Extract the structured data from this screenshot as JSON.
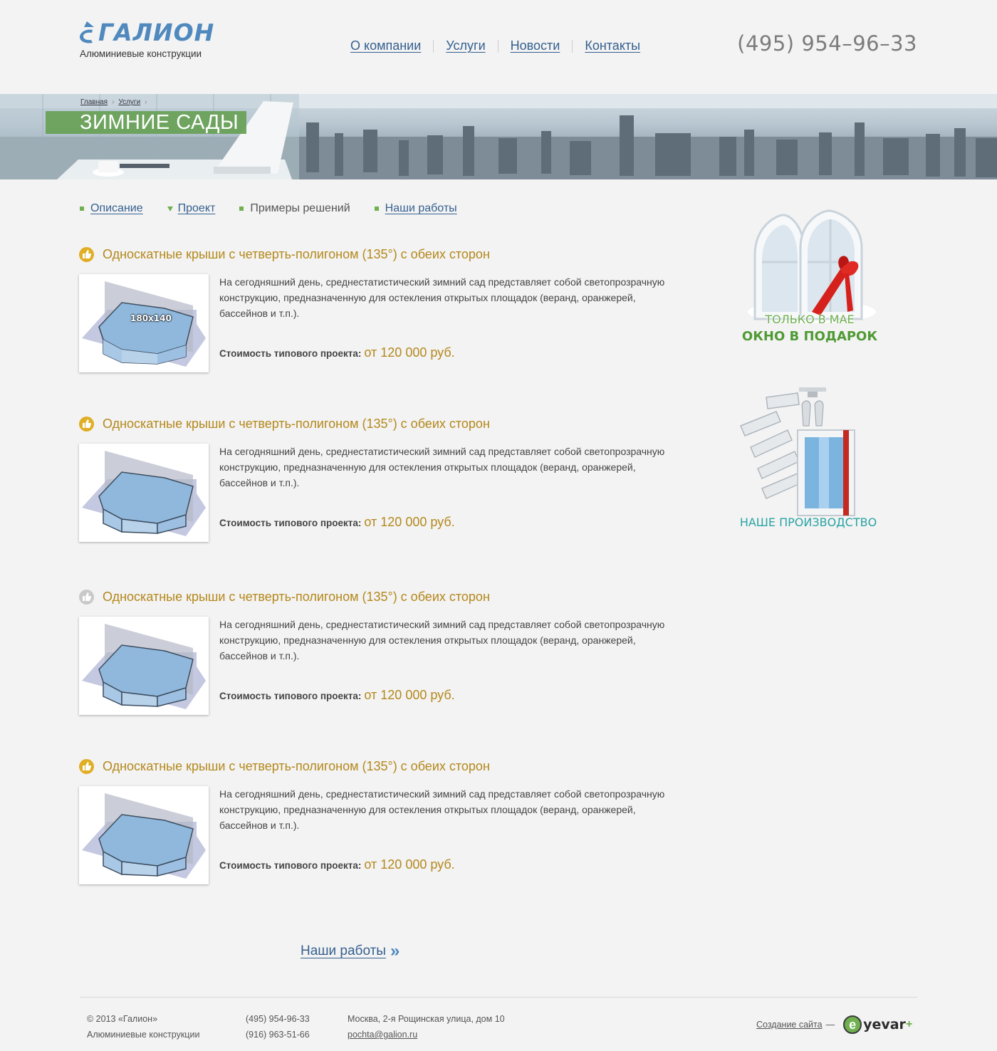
{
  "header": {
    "logo_text": "ГАЛИОН",
    "logo_sub": "Алюминиевые конструкции",
    "nav": [
      "О компании",
      "Услуги",
      "Новости",
      "Контакты"
    ],
    "phone": "(495) 954–96–33"
  },
  "banner": {
    "breadcrumbs": [
      "Главная",
      "Услуги"
    ],
    "title": "ЗИМНИЕ САДЫ"
  },
  "subnav": {
    "items": [
      "Описание",
      "Проект",
      "Примеры решений",
      "Наши работы"
    ]
  },
  "projects": [
    {
      "title": "Односкатные крыши с четверть-полигоном (135°) с обеих сторон",
      "image_label": "180x140",
      "description": "На сегодняшний день, среднестатистический зимний сад представляет собой светопрозрачную конструкцию, предназначенную для остекления открытых площадок (веранд, оранжерей, бассейнов и т.п.).",
      "price_label": "Стоимость типового проекта:",
      "price_value": "от 120 000 руб."
    },
    {
      "title": "Односкатные крыши с четверть-полигоном (135°) с обеих сторон",
      "description": "На сегодняшний день, среднестатистический зимний сад представляет собой светопрозрачную конструкцию, предназначенную для остекления открытых площадок (веранд, оранжерей, бассейнов и т.п.).",
      "price_label": "Стоимость типового проекта:",
      "price_value": "от 120 000 руб."
    },
    {
      "title": "Односкатные крыши с четверть-полигоном (135°) с обеих сторон",
      "description": "На сегодняшний день, среднестатистический зимний сад представляет собой светопрозрачную конструкцию, предназначенную для остекления открытых площадок (веранд, оранжерей, бассейнов и т.п.).",
      "price_label": "Стоимость типового проекта:",
      "price_value": "от 120 000 руб."
    },
    {
      "title": "Односкатные крыши с четверть-полигоном (135°) с обеих сторон",
      "description": "На сегодняшний день, среднестатистический зимний сад представляет собой светопрозрачную конструкцию, предназначенную для остекления открытых площадок (веранд, оранжерей, бассейнов и т.п.).",
      "price_label": "Стоимость типового проекта:",
      "price_value": "от 120 000 руб."
    }
  ],
  "sidebar": {
    "promo_line1": "ТОЛЬКО В МАЕ",
    "promo_line2": "ОКНО В ПОДАРОК",
    "production_label": "НАШЕ ПРОИЗВОДСТВО"
  },
  "more_link": "Наши работы",
  "footer": {
    "copyright": "© 2013  «Галион»",
    "company_sub": "Алюминиевые конструкции",
    "phone1": "(495) 954-96-33",
    "phone2": "(916) 963-51-66",
    "address": "Москва, 2-я Рощинская улица, дом 10",
    "email": "pochta@galion.ru",
    "creator_label": "Создание сайта",
    "creator_dash": "—",
    "creator_brand": "yevar"
  },
  "colors": {
    "accent_blue": "#35608f",
    "title_gold": "#b4881c",
    "green": "#6fb04f"
  }
}
